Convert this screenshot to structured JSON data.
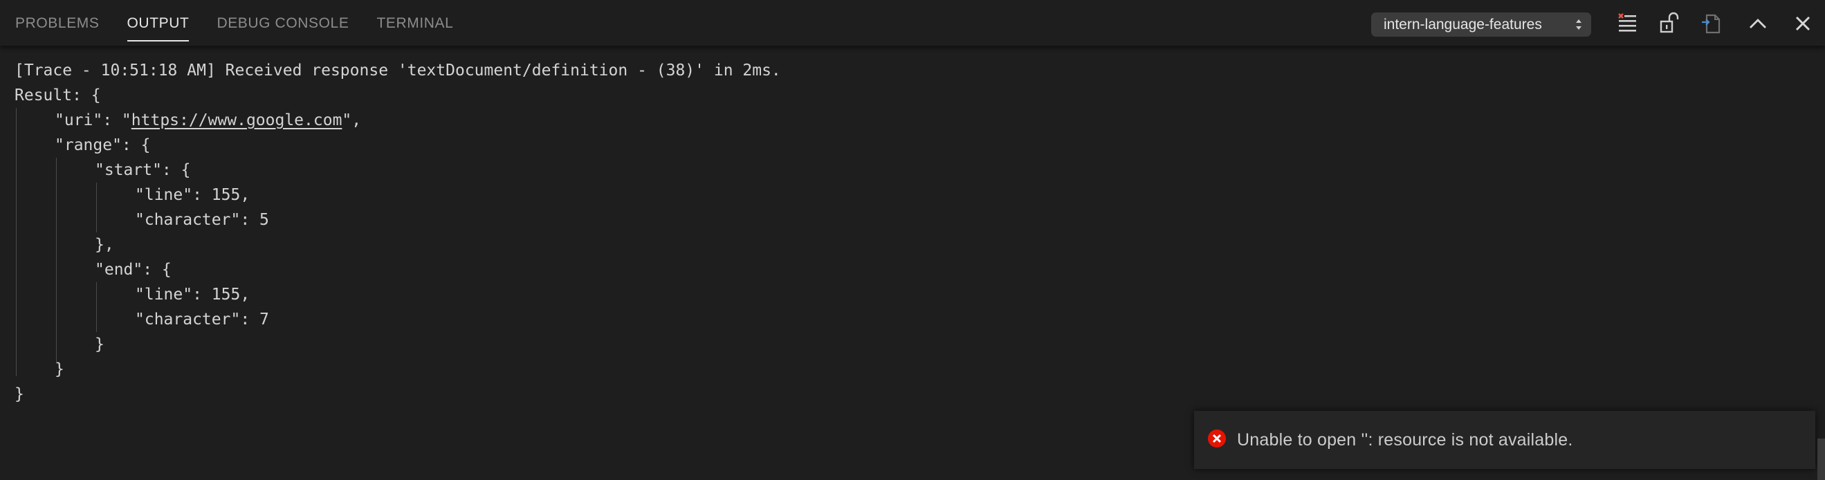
{
  "tabs": [
    {
      "label": "PROBLEMS",
      "active": false
    },
    {
      "label": "OUTPUT",
      "active": true
    },
    {
      "label": "DEBUG CONSOLE",
      "active": false
    },
    {
      "label": "TERMINAL",
      "active": false
    }
  ],
  "channel_select": {
    "value": "intern-language-features",
    "icon": "select-arrows-icon"
  },
  "actions": [
    {
      "name": "clear-output-button",
      "icon": "clear-all-icon",
      "tooltip": "Clear Output"
    },
    {
      "name": "lock-scroll-button",
      "icon": "unlock-icon",
      "tooltip": "Turn Auto Scrolling Off"
    },
    {
      "name": "open-log-file-button",
      "icon": "open-file-icon",
      "tooltip": "Open Log File"
    },
    {
      "name": "maximize-panel-button",
      "icon": "chevron-up-icon",
      "tooltip": "Maximize Panel Size"
    },
    {
      "name": "close-panel-button",
      "icon": "close-icon",
      "tooltip": "Close Panel"
    }
  ],
  "output": {
    "lines": [
      {
        "indent": 0,
        "text": "[Trace - 10:51:18 AM] Received response 'textDocument/definition - (38)' in 2ms."
      },
      {
        "indent": 0,
        "text": "Result: {"
      },
      {
        "indent": 1,
        "prefix": "\"uri\": \"",
        "link": "https://www.google.com",
        "suffix": "\","
      },
      {
        "indent": 1,
        "text": "\"range\": {"
      },
      {
        "indent": 2,
        "text": "\"start\": {"
      },
      {
        "indent": 3,
        "text": "\"line\": 155,"
      },
      {
        "indent": 3,
        "text": "\"character\": 5"
      },
      {
        "indent": 2,
        "text": "},"
      },
      {
        "indent": 2,
        "text": "\"end\": {"
      },
      {
        "indent": 3,
        "text": "\"line\": 155,"
      },
      {
        "indent": 3,
        "text": "\"character\": 7"
      },
      {
        "indent": 2,
        "text": "}"
      },
      {
        "indent": 1,
        "text": "}"
      },
      {
        "indent": 0,
        "text": "}"
      }
    ]
  },
  "notification": {
    "severity": "error",
    "icon": "error-icon",
    "message": "Unable to open '': resource is not available."
  },
  "colors": {
    "background": "#1e1e1e",
    "error": "#e51400",
    "text": "#d4d4d4"
  }
}
